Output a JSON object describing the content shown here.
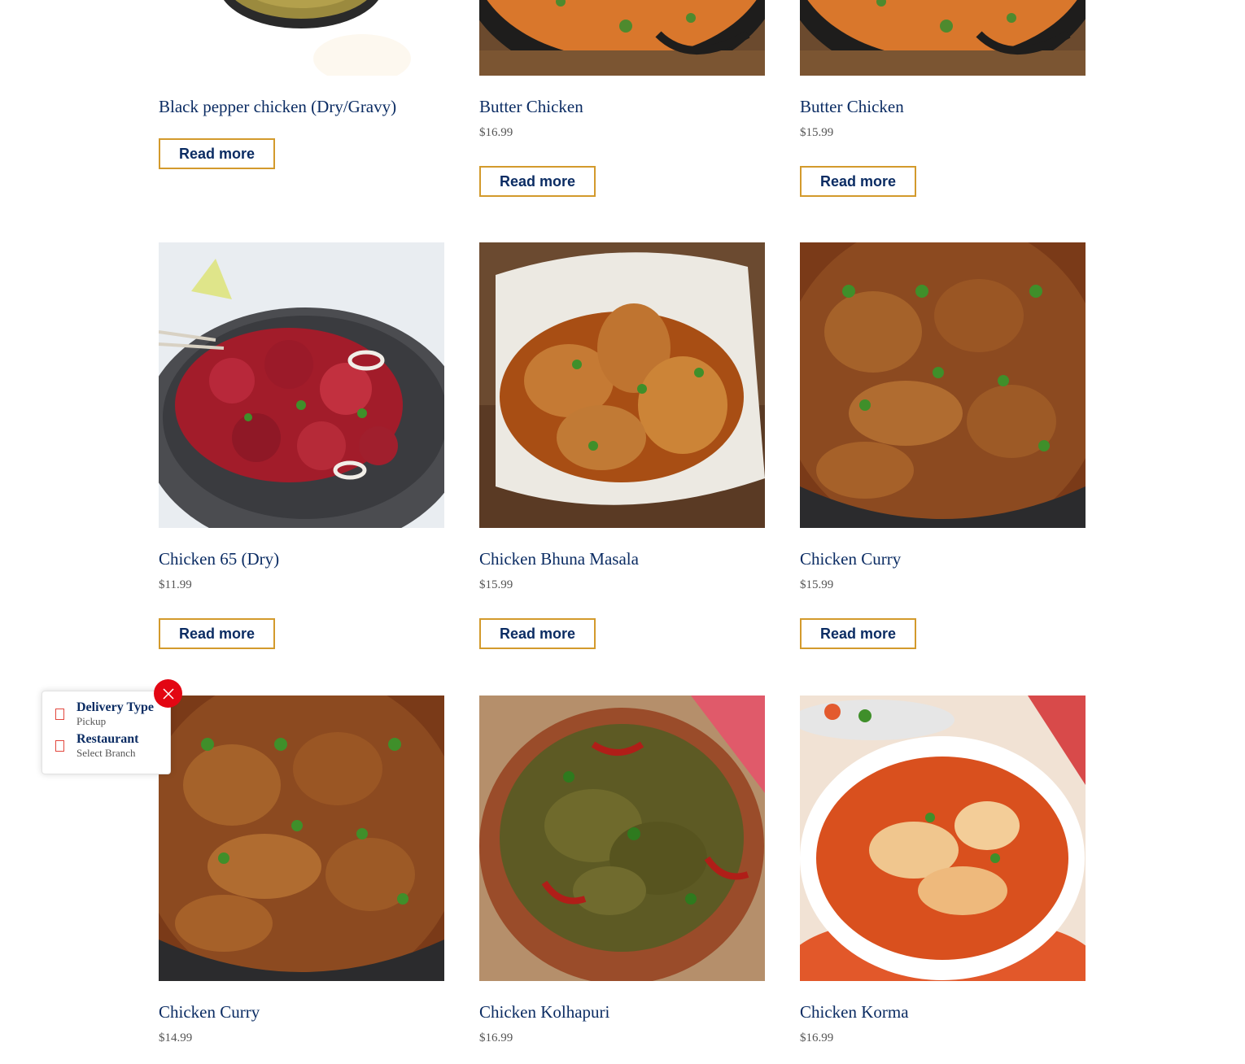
{
  "products": [
    {
      "name": "Black pepper chicken (Dry/Gravy)",
      "price": "",
      "button": "Read more"
    },
    {
      "name": "Butter Chicken",
      "price": "$16.99",
      "button": "Read more"
    },
    {
      "name": "Butter Chicken",
      "price": "$15.99",
      "button": "Read more"
    },
    {
      "name": "Chicken 65 (Dry)",
      "price": "$11.99",
      "button": "Read more"
    },
    {
      "name": "Chicken Bhuna Masala",
      "price": "$15.99",
      "button": "Read more"
    },
    {
      "name": "Chicken Curry",
      "price": "$15.99",
      "button": "Read more"
    },
    {
      "name": "Chicken Curry",
      "price": "$14.99",
      "button": "Read more"
    },
    {
      "name": "Chicken Kolhapuri",
      "price": "$16.99",
      "button": "Read more"
    },
    {
      "name": "Chicken Korma",
      "price": "$16.99",
      "button": "Read more"
    }
  ],
  "widget": {
    "delivery_label": "Delivery Type",
    "delivery_value": "Pickup",
    "restaurant_label": "Restaurant",
    "restaurant_value": "Select Branch",
    "close_icon": "close-icon",
    "row_icon": "outline-box-icon"
  },
  "colors": {
    "title": "#0b2c63",
    "button_border": "#d39a2c",
    "price": "#555555",
    "close_bg": "#e30613",
    "icon_outline": "#e2473d"
  }
}
